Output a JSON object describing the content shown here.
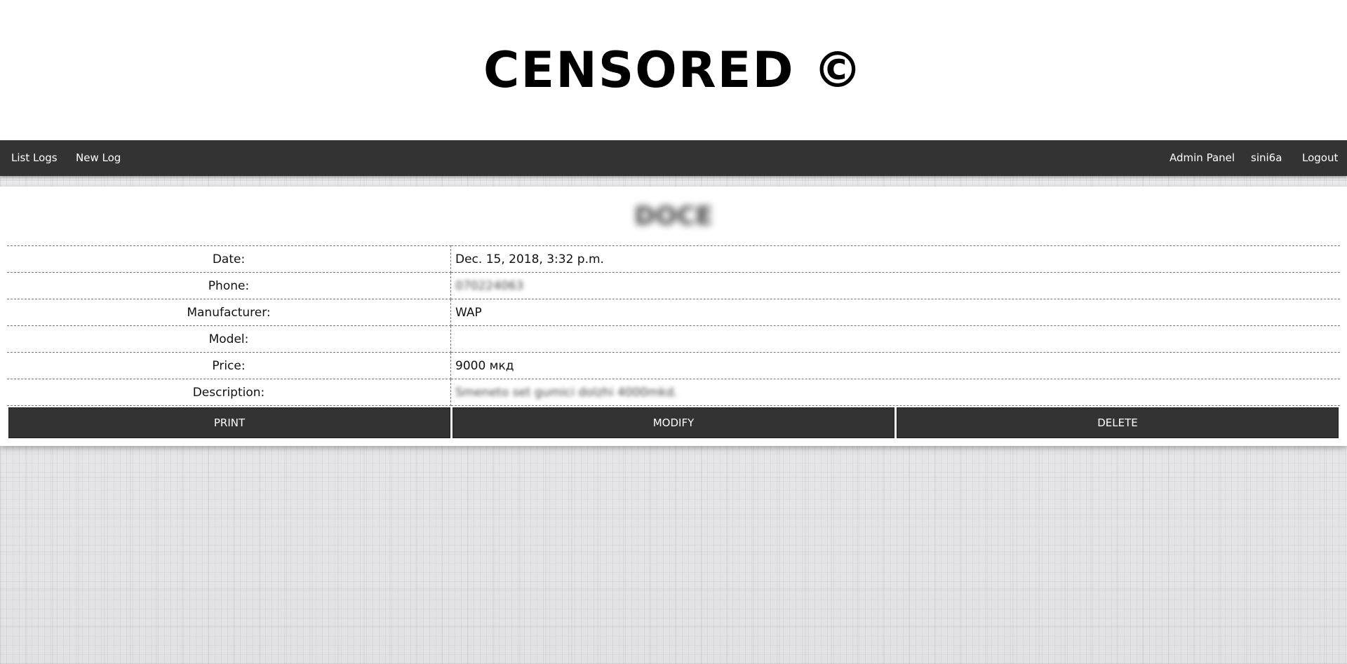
{
  "header": {
    "title": "CENSORED ©"
  },
  "nav": {
    "left": [
      {
        "label": "List Logs"
      },
      {
        "label": "New Log"
      }
    ],
    "right": [
      {
        "label": "Admin Panel"
      },
      {
        "label": "sini6a"
      },
      {
        "label": "Logout"
      }
    ]
  },
  "record": {
    "title": "DOCE",
    "rows": [
      {
        "label": "Date:",
        "value": "Dec. 15, 2018, 3:32 p.m."
      },
      {
        "label": "Phone:",
        "value": "070224063"
      },
      {
        "label": "Manufacturer:",
        "value": "WAP"
      },
      {
        "label": "Model:",
        "value": ""
      },
      {
        "label": "Price:",
        "value": "9000 мкд"
      },
      {
        "label": "Description:",
        "value": "Smeneto set gumici dolzhi 4000mkd."
      }
    ]
  },
  "actions": {
    "print": "PRINT",
    "modify": "MODIFY",
    "delete": "DELETE"
  },
  "colors": {
    "navbar": "#333333",
    "button": "#333333",
    "header_bg": "#ffffff",
    "text": "#000000"
  }
}
